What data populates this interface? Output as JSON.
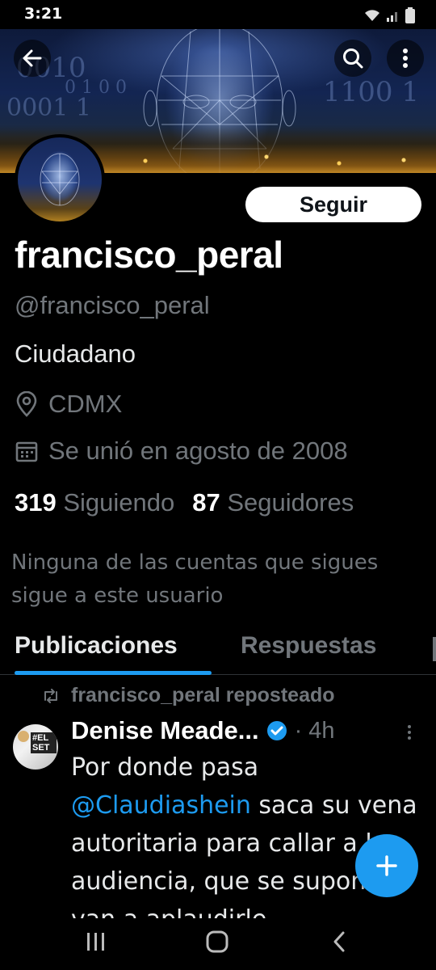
{
  "status_bar": {
    "time": "3:21"
  },
  "profile": {
    "name": "francisco_peral",
    "handle": "@francisco_peral",
    "bio": "Ciudadano",
    "location": "CDMX",
    "joined": "Se unió en agosto de 2008",
    "following_count": "319",
    "following_label": "Siguiendo",
    "followers_count": "87",
    "followers_label": "Seguidores",
    "mutual_note": "Ninguna de las cuentas que sigues sigue a este usuario",
    "follow_button": "Seguir"
  },
  "banner": {
    "bits_left": "0010",
    "bits_mid": "0 1 0 0",
    "bits_right": "1100 1",
    "bits_lower": "0001 1"
  },
  "tabs": [
    {
      "label": "Publicaciones",
      "active": true
    },
    {
      "label": "Respuestas",
      "active": false
    }
  ],
  "post": {
    "repost_label": "francisco_peral reposteado",
    "author": "Denise Meade...",
    "verified": true,
    "time": "4h",
    "avatar_text": "#EL SET",
    "text_1": "Por donde pasa",
    "mention": "@Claudiashein",
    "text_2": " saca su vena autoritaria para callar a la audiencia, que se supone van a aplaudirle"
  },
  "icons": {
    "back": "arrow-left-icon",
    "search": "search-icon",
    "more": "more-vertical-icon",
    "location": "location-pin-icon",
    "calendar": "calendar-icon",
    "repost": "repost-icon",
    "verified": "verified-badge-icon",
    "compose": "plus-icon"
  },
  "colors": {
    "accent": "#1d9bf0",
    "secondary_text": "#71767b",
    "background": "#000000"
  }
}
